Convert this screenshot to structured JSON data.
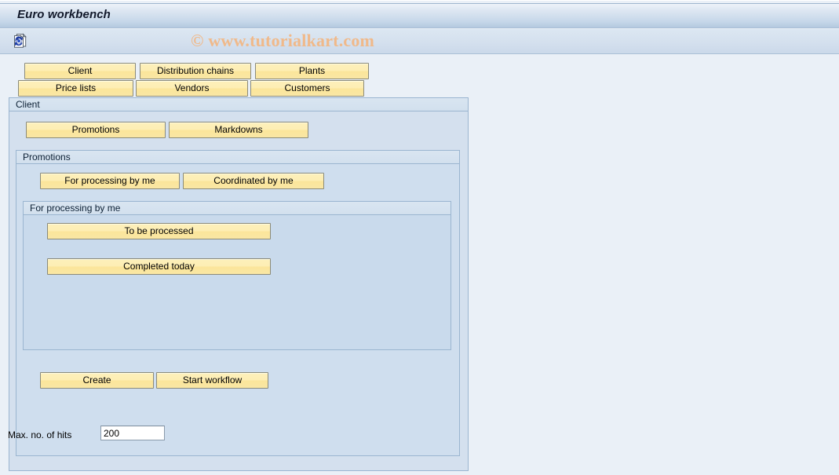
{
  "window": {
    "title": "Euro workbench"
  },
  "toolbar": {
    "buttons": [
      {
        "name": "refresh-document-icon",
        "label": ""
      }
    ]
  },
  "watermark": {
    "text": "© www.tutorialkart.com",
    "color": "#f0b98a"
  },
  "selection_buttons": {
    "row1": [
      {
        "label": "Client"
      },
      {
        "label": "Distribution chains"
      },
      {
        "label": "Plants"
      }
    ],
    "row2": [
      {
        "label": "Price lists"
      },
      {
        "label": "Vendors"
      },
      {
        "label": "Customers"
      }
    ]
  },
  "client_group": {
    "title": "Client",
    "buttons": [
      {
        "label": "Promotions"
      },
      {
        "label": "Markdowns"
      }
    ]
  },
  "promotions_group": {
    "title": "Promotions",
    "buttons": [
      {
        "label": "For processing by me"
      },
      {
        "label": "Coordinated by me"
      }
    ]
  },
  "processing_group": {
    "title": "For processing by me",
    "buttons": [
      {
        "label": "To be processed"
      },
      {
        "label": "Completed today"
      }
    ]
  },
  "action_buttons": [
    {
      "label": "Create"
    },
    {
      "label": "Start workflow"
    }
  ],
  "footer": {
    "hits_label": "Max. no. of hits",
    "hits_value": "200",
    "hits_placeholder": ""
  },
  "colors": {
    "button_face": "#fbe8a6",
    "group_header": "#d6e3f0",
    "group_body": "#cfdded",
    "title_bar": "#c6d7e9",
    "page_background": "#eaf0f7",
    "watermark": "#f0b98a"
  }
}
